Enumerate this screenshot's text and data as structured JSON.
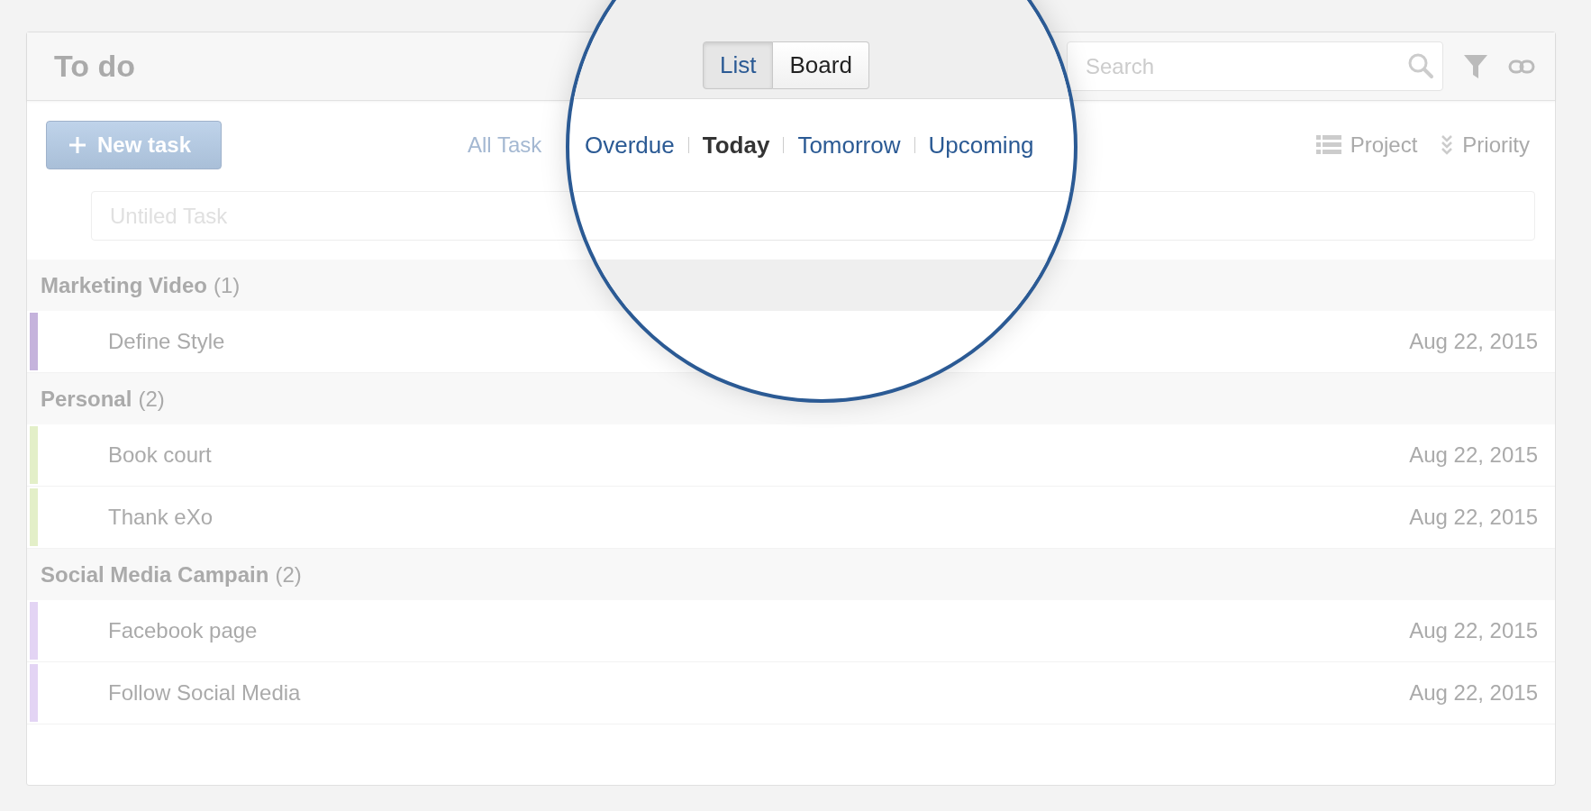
{
  "panel": {
    "title": "To do",
    "search": {
      "placeholder": "Search"
    },
    "new_task_button": {
      "label": "New task"
    },
    "filters": [
      {
        "label": "All Task",
        "selected": false
      }
    ],
    "sort_options": [
      {
        "label": "Project",
        "kind": "project"
      },
      {
        "label": "Priority",
        "kind": "priority"
      }
    ],
    "new_task_field": {
      "placeholder": "Untiled Task"
    },
    "groups": [
      {
        "name": "Marketing Video",
        "count": "(1)",
        "tasks": [
          {
            "title": "Define Style",
            "date": "Aug 22, 2015",
            "color": "#c5b3dc"
          }
        ]
      },
      {
        "name": "Personal",
        "count": "(2)",
        "tasks": [
          {
            "title": "Book court",
            "date": "Aug 22, 2015",
            "color": "#e3efc8"
          },
          {
            "title": "Thank eXo",
            "date": "Aug 22, 2015",
            "color": "#e3efc8"
          }
        ]
      },
      {
        "name": "Social Media Campain",
        "count": "(2)",
        "tasks": [
          {
            "title": "Facebook page",
            "date": "Aug 22, 2015",
            "color": "#e3d4f4"
          },
          {
            "title": "Follow Social Media",
            "date": "Aug 22, 2015",
            "color": "#e3d4f4"
          }
        ]
      }
    ]
  },
  "magnifier": {
    "view_toggle": [
      {
        "label": "List",
        "selected": true
      },
      {
        "label": "Board",
        "selected": false
      }
    ],
    "filters": [
      {
        "label": "Overdue",
        "selected": false
      },
      {
        "label": "Today",
        "selected": true
      },
      {
        "label": "Tomorrow",
        "selected": false
      },
      {
        "label": "Upcoming",
        "selected": false
      }
    ]
  }
}
